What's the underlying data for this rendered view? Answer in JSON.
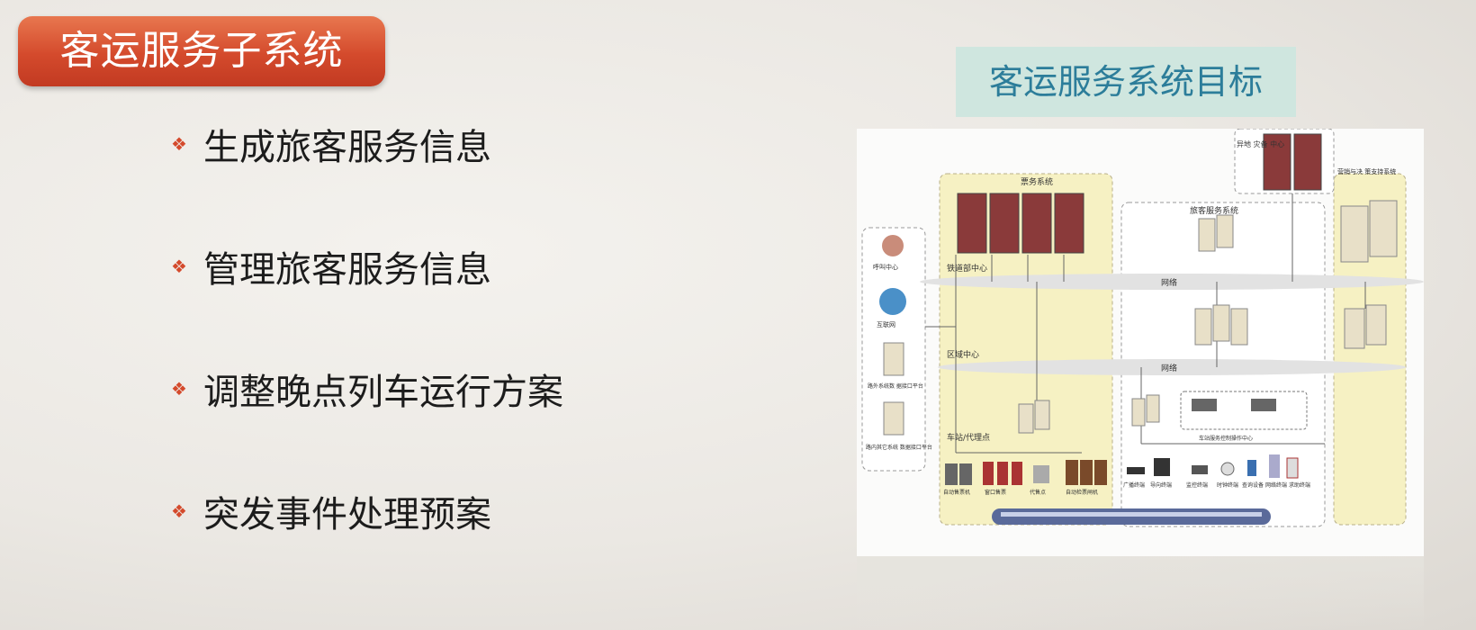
{
  "slide": {
    "title": "客运服务子系统",
    "bullets": [
      "生成旅客服务信息",
      "管理旅客服务信息",
      "调整晚点列车运行方案",
      "突发事件处理预案"
    ],
    "target_label": "客运服务系统目标"
  },
  "diagram": {
    "backup_center": "异地\n灾备\n中心",
    "ticket_system": "票务系统",
    "passenger_service": "旅客服务系统",
    "marketing": "营销与决\n策支持系统",
    "railway_center": "铁道部中心",
    "regional_center": "区域中心",
    "station": "车站/代理点",
    "network": "网络",
    "call_center": "呼叫中心",
    "internet": "互联网",
    "external_platform": "路外系统数\n据接口平台",
    "other_platform": "路内其它系统\n数据接口平台",
    "ticket_machine": "自动售票机",
    "window": "窗口售票",
    "agent": "代售点",
    "gate": "自动检票闸机",
    "terminals": [
      "广播终端",
      "导向终端",
      "监控终端",
      "时钟终端",
      "查询设备",
      "网络终端",
      "求助终端"
    ],
    "station_control": "车站服务控制操作中心"
  },
  "colors": {
    "accent": "#d44a2c",
    "target_bg": "#cfe6df",
    "target_text": "#2c7d9a",
    "zone_yellow": "#f6f1c3"
  }
}
